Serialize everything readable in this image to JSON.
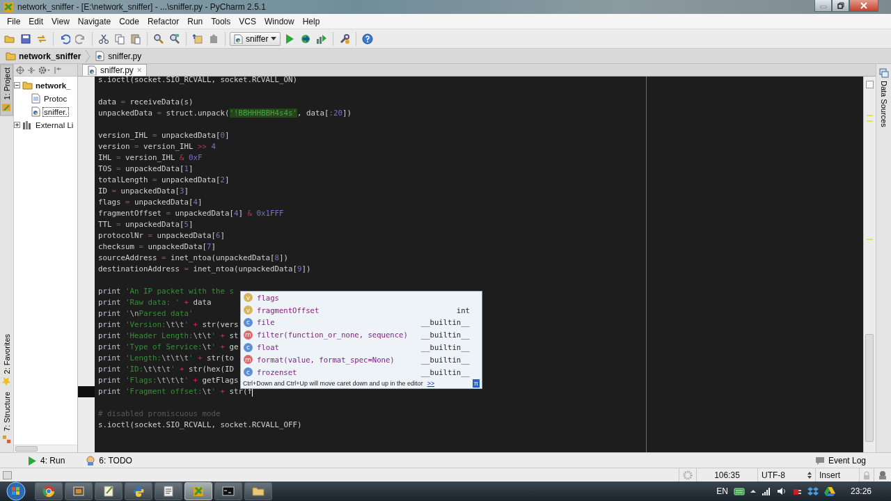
{
  "window": {
    "title": "network_sniffer - [E:\\network_sniffer] - ...\\sniffer.py - PyCharm 2.5.1"
  },
  "menu": [
    "File",
    "Edit",
    "View",
    "Navigate",
    "Code",
    "Refactor",
    "Run",
    "Tools",
    "VCS",
    "Window",
    "Help"
  ],
  "run_config": "sniffer",
  "breadcrumbs": [
    "network_sniffer",
    "sniffer.py"
  ],
  "left_tool_tabs": [
    {
      "label": "1: Project",
      "selected": true
    },
    {
      "label": "2: Favorites",
      "selected": false
    },
    {
      "label": "7: Structure",
      "selected": false
    }
  ],
  "right_tool_tabs": [
    {
      "label": "Data Sources",
      "selected": false
    }
  ],
  "project_tree": [
    {
      "label": "network_",
      "expanded": true,
      "selected": false,
      "children": [
        {
          "label": "Protoc",
          "selected": false
        },
        {
          "label": "sniffer.",
          "selected": true
        }
      ]
    },
    {
      "label": "External Li",
      "expanded": false,
      "selected": false
    }
  ],
  "editor_tabs": [
    {
      "label": "sniffer.py",
      "close": "×",
      "selected": true
    }
  ],
  "code_lines": [
    {
      "current": false,
      "tokens": [
        {
          "kind": "plain",
          "text": "s.ioctl(socket.SIO_RCVALL, socket.RCVALL_ON)"
        }
      ]
    },
    {
      "current": false
    },
    {
      "current": false,
      "tokens": [
        {
          "kind": "plain",
          "text": "data "
        },
        {
          "kind": "op",
          "text": "="
        },
        {
          "kind": "plain",
          "text": " receiveData(s)"
        }
      ]
    },
    {
      "current": false,
      "tokens": [
        {
          "kind": "plain",
          "text": "unpackedData "
        },
        {
          "kind": "op",
          "text": "="
        },
        {
          "kind": "plain",
          "text": " struct.unpack("
        },
        {
          "kind": "strhl",
          "text": "'!BBHHHBBH4s4s'"
        },
        {
          "kind": "plain",
          "text": ", data["
        },
        {
          "kind": "num",
          "text": ":20"
        },
        {
          "kind": "plain",
          "text": "])"
        }
      ]
    },
    {
      "current": false
    },
    {
      "current": false,
      "tokens": [
        {
          "kind": "plain",
          "text": "version_IHL "
        },
        {
          "kind": "op",
          "text": "="
        },
        {
          "kind": "plain",
          "text": " unpackedData["
        },
        {
          "kind": "num",
          "text": "0"
        },
        {
          "kind": "plain",
          "text": "]"
        }
      ]
    },
    {
      "current": false,
      "tokens": [
        {
          "kind": "plain",
          "text": "version "
        },
        {
          "kind": "op",
          "text": "="
        },
        {
          "kind": "plain",
          "text": " version_IHL "
        },
        {
          "kind": "op",
          "text": ">>"
        },
        {
          "kind": "num",
          "text": " 4"
        }
      ]
    },
    {
      "current": false,
      "tokens": [
        {
          "kind": "plain",
          "text": "IHL "
        },
        {
          "kind": "op",
          "text": "="
        },
        {
          "kind": "plain",
          "text": " version_IHL "
        },
        {
          "kind": "op",
          "text": "&"
        },
        {
          "kind": "num",
          "text": " 0xF"
        }
      ]
    },
    {
      "current": false,
      "tokens": [
        {
          "kind": "plain",
          "text": "TOS "
        },
        {
          "kind": "op",
          "text": "="
        },
        {
          "kind": "plain",
          "text": " unpackedData["
        },
        {
          "kind": "num",
          "text": "1"
        },
        {
          "kind": "plain",
          "text": "]"
        }
      ]
    },
    {
      "current": false,
      "tokens": [
        {
          "kind": "plain",
          "text": "totalLength "
        },
        {
          "kind": "op",
          "text": "="
        },
        {
          "kind": "plain",
          "text": " unpackedData["
        },
        {
          "kind": "num",
          "text": "2"
        },
        {
          "kind": "plain",
          "text": "]"
        }
      ]
    },
    {
      "current": false,
      "tokens": [
        {
          "kind": "plain",
          "text": "ID "
        },
        {
          "kind": "op",
          "text": "="
        },
        {
          "kind": "plain",
          "text": " unpackedData["
        },
        {
          "kind": "num",
          "text": "3"
        },
        {
          "kind": "plain",
          "text": "]"
        }
      ]
    },
    {
      "current": false,
      "tokens": [
        {
          "kind": "plain",
          "text": "flags "
        },
        {
          "kind": "op",
          "text": "="
        },
        {
          "kind": "plain",
          "text": " unpackedData["
        },
        {
          "kind": "num",
          "text": "4"
        },
        {
          "kind": "plain",
          "text": "]"
        }
      ]
    },
    {
      "current": false,
      "tokens": [
        {
          "kind": "plain",
          "text": "fragmentOffset "
        },
        {
          "kind": "op",
          "text": "="
        },
        {
          "kind": "plain",
          "text": " unpackedData["
        },
        {
          "kind": "num",
          "text": "4"
        },
        {
          "kind": "plain",
          "text": "] "
        },
        {
          "kind": "op",
          "text": "&"
        },
        {
          "kind": "num",
          "text": " 0x1FFF"
        }
      ]
    },
    {
      "current": false,
      "tokens": [
        {
          "kind": "plain",
          "text": "TTL "
        },
        {
          "kind": "op",
          "text": "="
        },
        {
          "kind": "plain",
          "text": " unpackedData["
        },
        {
          "kind": "num",
          "text": "5"
        },
        {
          "kind": "plain",
          "text": "]"
        }
      ]
    },
    {
      "current": false,
      "tokens": [
        {
          "kind": "plain",
          "text": "protocolNr "
        },
        {
          "kind": "op",
          "text": "="
        },
        {
          "kind": "plain",
          "text": " unpackedData["
        },
        {
          "kind": "num",
          "text": "6"
        },
        {
          "kind": "plain",
          "text": "]"
        }
      ]
    },
    {
      "current": false,
      "tokens": [
        {
          "kind": "plain",
          "text": "checksum "
        },
        {
          "kind": "op",
          "text": "="
        },
        {
          "kind": "plain",
          "text": " unpackedData["
        },
        {
          "kind": "num",
          "text": "7"
        },
        {
          "kind": "plain",
          "text": "]"
        }
      ]
    },
    {
      "current": false,
      "tokens": [
        {
          "kind": "plain",
          "text": "sourceAddress "
        },
        {
          "kind": "op",
          "text": "="
        },
        {
          "kind": "plain",
          "text": " inet_ntoa(unpackedData["
        },
        {
          "kind": "num",
          "text": "8"
        },
        {
          "kind": "plain",
          "text": "])"
        }
      ]
    },
    {
      "current": false,
      "tokens": [
        {
          "kind": "plain",
          "text": "destinationAddress "
        },
        {
          "kind": "op",
          "text": "="
        },
        {
          "kind": "plain",
          "text": " inet_ntoa(unpackedData["
        },
        {
          "kind": "num",
          "text": "9"
        },
        {
          "kind": "plain",
          "text": "])"
        }
      ]
    },
    {
      "current": false
    },
    {
      "current": false,
      "tokens": [
        {
          "kind": "kw",
          "text": "print "
        },
        {
          "kind": "str",
          "text": "'An IP packet with the s"
        }
      ]
    },
    {
      "current": false,
      "tokens": [
        {
          "kind": "kw",
          "text": "print "
        },
        {
          "kind": "str",
          "text": "'Raw data: '"
        },
        {
          "kind": "op",
          "text": " + "
        },
        {
          "kind": "plain",
          "text": "data"
        }
      ]
    },
    {
      "current": false,
      "tokens": [
        {
          "kind": "kw",
          "text": "print "
        },
        {
          "kind": "str",
          "text": "'"
        },
        {
          "kind": "esc",
          "text": "\\n"
        },
        {
          "kind": "str",
          "text": "Parsed data'"
        }
      ]
    },
    {
      "current": false,
      "tokens": [
        {
          "kind": "kw",
          "text": "print "
        },
        {
          "kind": "str",
          "text": "'Version:"
        },
        {
          "kind": "esc",
          "text": "\\t\\t"
        },
        {
          "kind": "str",
          "text": "'"
        },
        {
          "kind": "op",
          "text": " + "
        },
        {
          "kind": "plain",
          "text": "str(vers"
        }
      ]
    },
    {
      "current": false,
      "tokens": [
        {
          "kind": "kw",
          "text": "print "
        },
        {
          "kind": "str",
          "text": "'Header Length:"
        },
        {
          "kind": "esc",
          "text": "\\t\\t"
        },
        {
          "kind": "str",
          "text": "'"
        },
        {
          "kind": "op",
          "text": " + "
        },
        {
          "kind": "plain",
          "text": "st"
        }
      ]
    },
    {
      "current": false,
      "tokens": [
        {
          "kind": "kw",
          "text": "print "
        },
        {
          "kind": "str",
          "text": "'Type of Service:"
        },
        {
          "kind": "esc",
          "text": "\\t"
        },
        {
          "kind": "str",
          "text": "'"
        },
        {
          "kind": "op",
          "text": " + "
        },
        {
          "kind": "plain",
          "text": "ge"
        }
      ]
    },
    {
      "current": false,
      "tokens": [
        {
          "kind": "kw",
          "text": "print "
        },
        {
          "kind": "str",
          "text": "'Length:"
        },
        {
          "kind": "esc",
          "text": "\\t\\t\\t"
        },
        {
          "kind": "str",
          "text": "'"
        },
        {
          "kind": "op",
          "text": " + "
        },
        {
          "kind": "plain",
          "text": "str(to"
        }
      ]
    },
    {
      "current": false,
      "tokens": [
        {
          "kind": "kw",
          "text": "print "
        },
        {
          "kind": "str",
          "text": "'ID:"
        },
        {
          "kind": "esc",
          "text": "\\t\\t\\t"
        },
        {
          "kind": "str",
          "text": "'"
        },
        {
          "kind": "op",
          "text": " + "
        },
        {
          "kind": "plain",
          "text": "str(hex(ID"
        }
      ]
    },
    {
      "current": false,
      "tokens": [
        {
          "kind": "kw",
          "text": "print "
        },
        {
          "kind": "str",
          "text": "'Flags:"
        },
        {
          "kind": "esc",
          "text": "\\t\\t\\t"
        },
        {
          "kind": "str",
          "text": "'"
        },
        {
          "kind": "op",
          "text": " + "
        },
        {
          "kind": "plain",
          "text": "getFlags"
        }
      ]
    },
    {
      "current": true,
      "tokens": [
        {
          "kind": "kw",
          "text": "print "
        },
        {
          "kind": "str",
          "text": "'Fragment offset:"
        },
        {
          "kind": "esc",
          "text": "\\t"
        },
        {
          "kind": "str",
          "text": "'"
        },
        {
          "kind": "op",
          "text": " + "
        },
        {
          "kind": "plain",
          "text": "str(f"
        }
      ]
    },
    {
      "current": false
    },
    {
      "current": false,
      "tokens": [
        {
          "kind": "comment",
          "text": "# disabled promiscuous mode"
        }
      ]
    },
    {
      "current": false,
      "tokens": [
        {
          "kind": "plain",
          "text": "s.ioctl(socket.SIO_RCVALL, socket.RCVALL_OFF)"
        }
      ]
    }
  ],
  "completion": {
    "items": [
      {
        "kind": "variable",
        "badge": "v",
        "name": "flags"
      },
      {
        "kind": "variable",
        "badge": "v",
        "name": "fragmentOffset",
        "type": "int"
      },
      {
        "kind": "class",
        "badge": "c",
        "name": "file",
        "type": "__builtin__"
      },
      {
        "kind": "method",
        "badge": "m",
        "name": "filter(function_or_none, sequence)",
        "type": "__builtin__"
      },
      {
        "kind": "class",
        "badge": "c",
        "name": "float",
        "type": "__builtin__"
      },
      {
        "kind": "method",
        "badge": "m",
        "name": "format(value, format_spec=None)",
        "type": "__builtin__"
      },
      {
        "kind": "class",
        "badge": "c",
        "name": "frozenset",
        "type": "__builtin__"
      }
    ],
    "hint": "Ctrl+Down and Ctrl+Up will move caret down and up in the editor",
    "more": ">>",
    "pin": "π"
  },
  "bottom_tool_tabs": [
    {
      "label": "4: Run",
      "selected": false
    },
    {
      "label": "6: TODO",
      "selected": false
    }
  ],
  "event_log": "Event Log",
  "status_bar": {
    "position": "106:35",
    "encoding": "UTF-8",
    "mode": "Insert"
  },
  "taskbar": {
    "apps": [
      {
        "selected": false
      },
      {
        "selected": false
      },
      {
        "selected": false
      },
      {
        "selected": false
      },
      {
        "selected": false
      },
      {
        "selected": true
      },
      {
        "selected": false
      },
      {
        "selected": false
      }
    ],
    "language": "EN",
    "clock": "23:26"
  }
}
